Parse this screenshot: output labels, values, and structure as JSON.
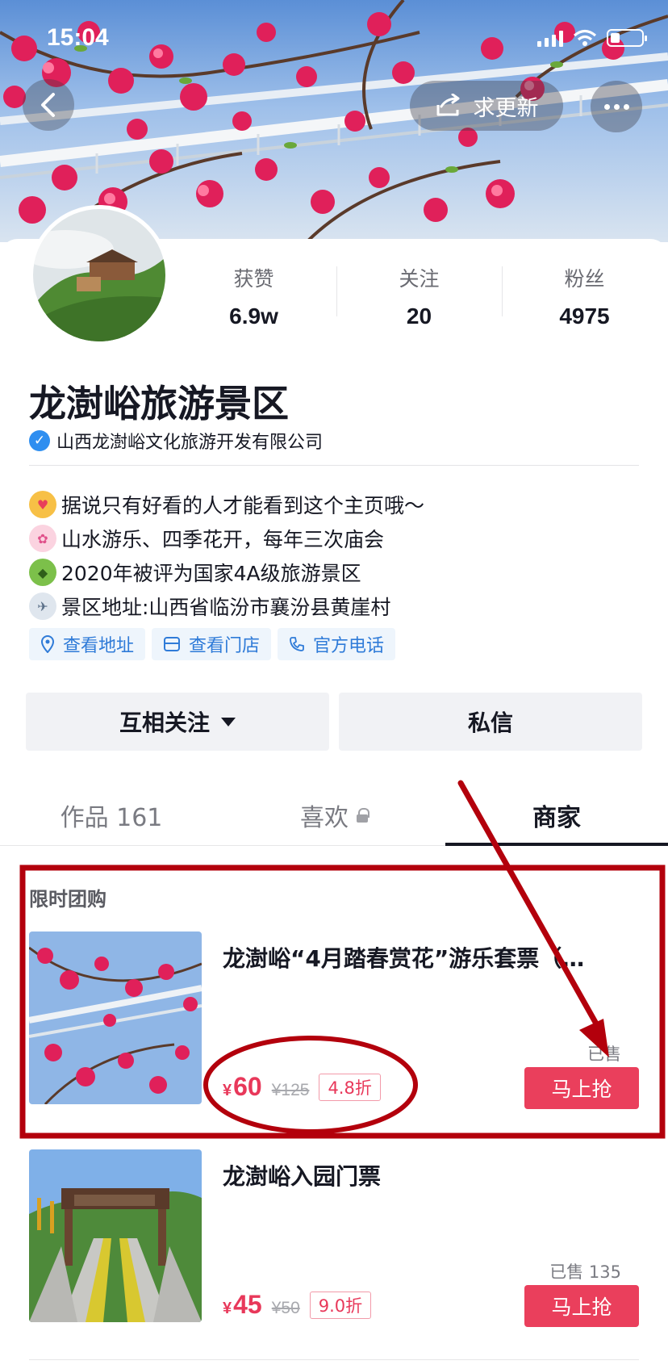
{
  "status_bar": {
    "time": "15:04"
  },
  "header": {
    "update_label": "求更新"
  },
  "profile": {
    "stats": [
      {
        "label": "获赞",
        "value": "6.9w"
      },
      {
        "label": "关注",
        "value": "20"
      },
      {
        "label": "粉丝",
        "value": "4975"
      }
    ],
    "name": "龙澍峪旅游景区",
    "verified_company": "山西龙澍峪文化旅游开发有限公司",
    "bio": [
      {
        "emoji": "smiling-face-with-hearts",
        "text": "据说只有好看的人才能看到这个主页哦～"
      },
      {
        "emoji": "cherry-blossom",
        "text": "山水游乐、四季花开，每年三次庙会"
      },
      {
        "emoji": "dragon-face",
        "text": " 2020年被评为国家4A级旅游景区"
      },
      {
        "emoji": "airplane",
        "text": "景区地址:山西省临汾市襄汾县黄崖村"
      }
    ],
    "chips": [
      {
        "icon": "location-pin-icon",
        "label": "查看地址"
      },
      {
        "icon": "store-icon",
        "label": "查看门店"
      },
      {
        "icon": "phone-icon",
        "label": "官方电话"
      }
    ]
  },
  "actions": {
    "follow_label": "互相关注",
    "message_label": "私信"
  },
  "tabs": [
    {
      "label": "作品 161"
    },
    {
      "label": "喜欢"
    },
    {
      "label": "商家"
    }
  ],
  "shop": {
    "section_title": "限时团购",
    "products": [
      {
        "title": "龙澍峪“4月踏春赏花”游乐套票（…",
        "currency": "¥",
        "price": "60",
        "original_price": "¥125",
        "discount": "4.8折",
        "sold": "已售",
        "buy_label": "马上抢"
      },
      {
        "title": "龙澍峪入园门票",
        "currency": "¥",
        "price": "45",
        "original_price": "¥50",
        "discount": "9.0折",
        "sold": "已售 135",
        "buy_label": "马上抢"
      }
    ]
  },
  "colors": {
    "accent_red": "#ea3f5c",
    "annotation_red": "#b3000c",
    "link_blue": "#2f7bd8"
  }
}
